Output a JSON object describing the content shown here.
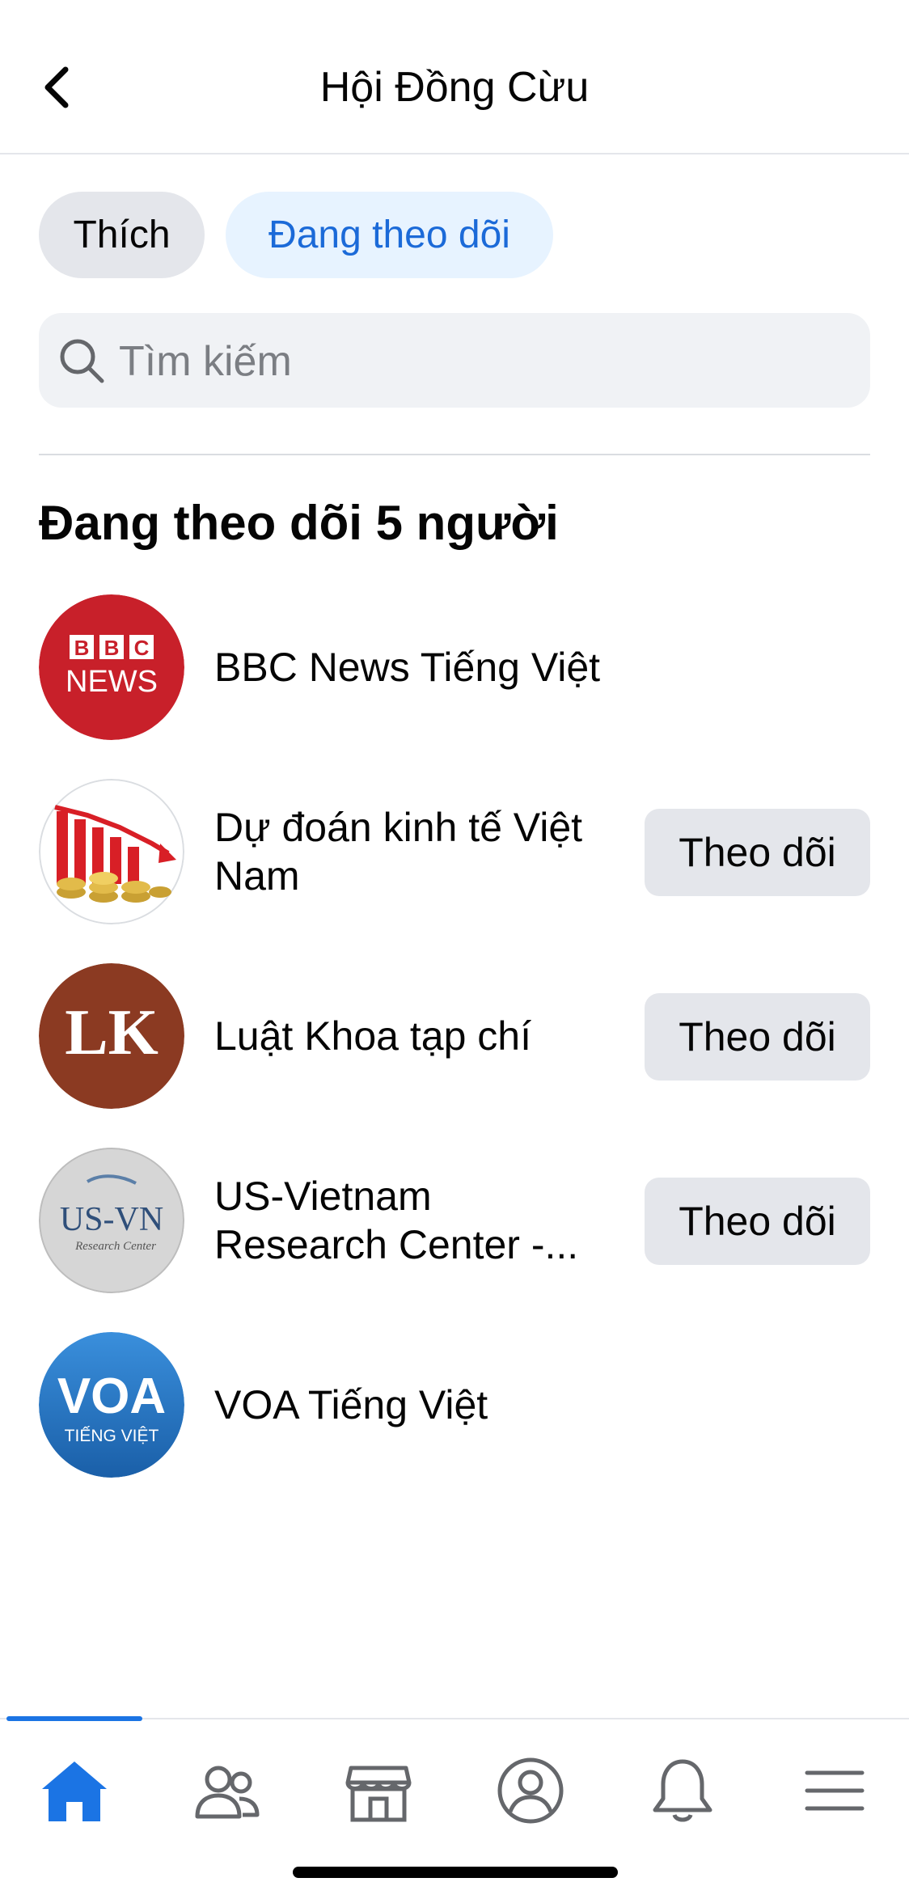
{
  "header": {
    "title": "Hội Đồng Cừu"
  },
  "filters": {
    "like": "Thích",
    "following": "Đang theo dõi"
  },
  "search": {
    "placeholder": "Tìm kiếm"
  },
  "section": {
    "title": "Đang theo dõi 5 người"
  },
  "pages": [
    {
      "name": "BBC News Tiếng Việt",
      "follow_label": "",
      "avatar_text_top": "BBC",
      "avatar_text_bottom": "NEWS"
    },
    {
      "name": "Dự đoán kinh tế Việt Nam",
      "follow_label": "Theo dõi"
    },
    {
      "name": "Luật Khoa tạp chí",
      "follow_label": "Theo dõi",
      "avatar_text": "LK"
    },
    {
      "name": "US-Vietnam Research Center -...",
      "follow_label": "Theo dõi",
      "avatar_text": "US-VN",
      "avatar_subtext": "Research Center"
    },
    {
      "name": "VOA Tiếng Việt",
      "follow_label": "",
      "avatar_text": "VOA",
      "avatar_subtext": "TIẾNG VIỆT"
    }
  ],
  "colors": {
    "accent": "#1b74e4",
    "chip_active_bg": "#e7f3ff",
    "chip_bg": "#e4e6eb",
    "bbc_red": "#c8202a",
    "lk_brown": "#8b3a22",
    "voa_blue": "#1e6fc0"
  },
  "tabbar": {
    "icons": [
      "home-icon",
      "friends-icon",
      "marketplace-icon",
      "profile-icon",
      "notifications-icon",
      "menu-icon"
    ]
  }
}
